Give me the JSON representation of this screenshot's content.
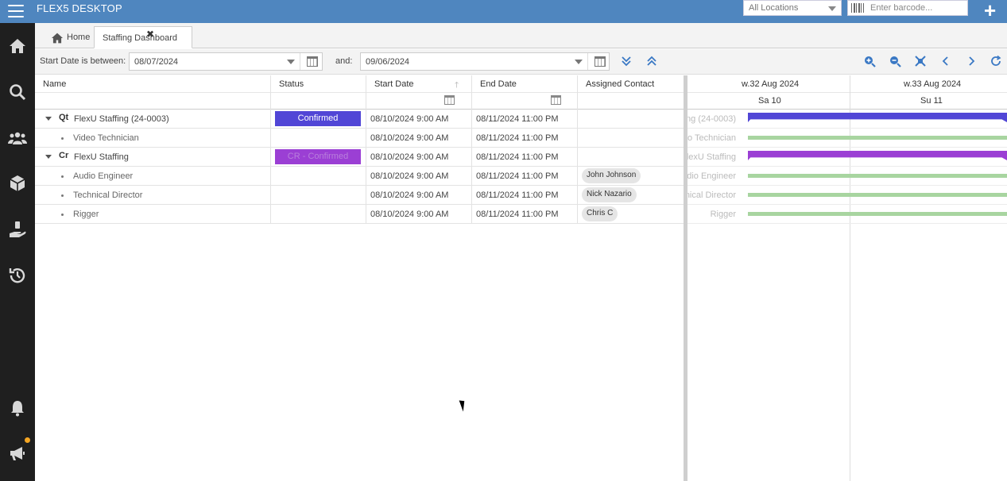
{
  "app": {
    "title": "FLEX5 DESKTOP"
  },
  "topbar": {
    "location_select": "All Locations",
    "barcode_placeholder": "Enter barcode..."
  },
  "tabs": [
    {
      "label": "Home"
    },
    {
      "label": "Staffing Dashboard"
    }
  ],
  "filter": {
    "start_label": "Start Date is between:",
    "start_value": "08/07/2024",
    "and_label": "and:",
    "end_value": "09/06/2024"
  },
  "columns": {
    "name": "Name",
    "status": "Status",
    "start_date": "Start Date",
    "end_date": "End Date",
    "assigned_contact": "Assigned Contact"
  },
  "rows": [
    {
      "badge": "Qt",
      "name": "FlexU Staffing (24-0003)",
      "status": "Confirmed",
      "status_color": "#5146d6",
      "start": "08/10/2024 9:00 AM",
      "end": "08/11/2024 11:00 PM",
      "contact": "",
      "gantt_label": "ng (24-0003)"
    },
    {
      "badge": "",
      "name": "Video Technician",
      "status": "",
      "start": "08/10/2024 9:00 AM",
      "end": "08/11/2024 11:00 PM",
      "contact": "",
      "gantt_label": "eo Technician"
    },
    {
      "badge": "Cr",
      "name": "FlexU Staffing",
      "status": "CR - Confirmed",
      "status_color": "#9b3fd4",
      "start": "08/10/2024 9:00 AM",
      "end": "08/11/2024 11:00 PM",
      "contact": "",
      "gantt_label": "FlexU Staffing"
    },
    {
      "badge": "",
      "name": "Audio Engineer",
      "status": "",
      "start": "08/10/2024 9:00 AM",
      "end": "08/11/2024 11:00 PM",
      "contact": "John Johnson",
      "gantt_label": "udio Engineer"
    },
    {
      "badge": "",
      "name": "Technical Director",
      "status": "",
      "start": "08/10/2024 9:00 AM",
      "end": "08/11/2024 11:00 PM",
      "contact": "Nick Nazario",
      "gantt_label": "nical Director"
    },
    {
      "badge": "",
      "name": "Rigger",
      "status": "",
      "start": "08/10/2024 9:00 AM",
      "end": "08/11/2024 11:00 PM",
      "contact": "Chris C",
      "gantt_label": "Rigger"
    }
  ],
  "gantt": {
    "weeks": [
      "w.32 Aug 2024",
      "w.33 Aug 2024"
    ],
    "days": [
      "Sa 10",
      "Su 11"
    ],
    "bar_colors": {
      "quote": "#5146d6",
      "crew": "#9b3fd4",
      "item": "#a8d5a0"
    }
  },
  "icons": {
    "sidebar": [
      "home-icon",
      "search-icon",
      "people-icon",
      "box-icon",
      "hand-money-icon",
      "history-icon",
      "bell-icon",
      "megaphone-icon"
    ],
    "toolbar": [
      "expand-all-icon",
      "collapse-all-icon",
      "zoom-in-icon",
      "zoom-out-icon",
      "fit-icon",
      "prev-icon",
      "next-icon",
      "refresh-icon"
    ]
  }
}
